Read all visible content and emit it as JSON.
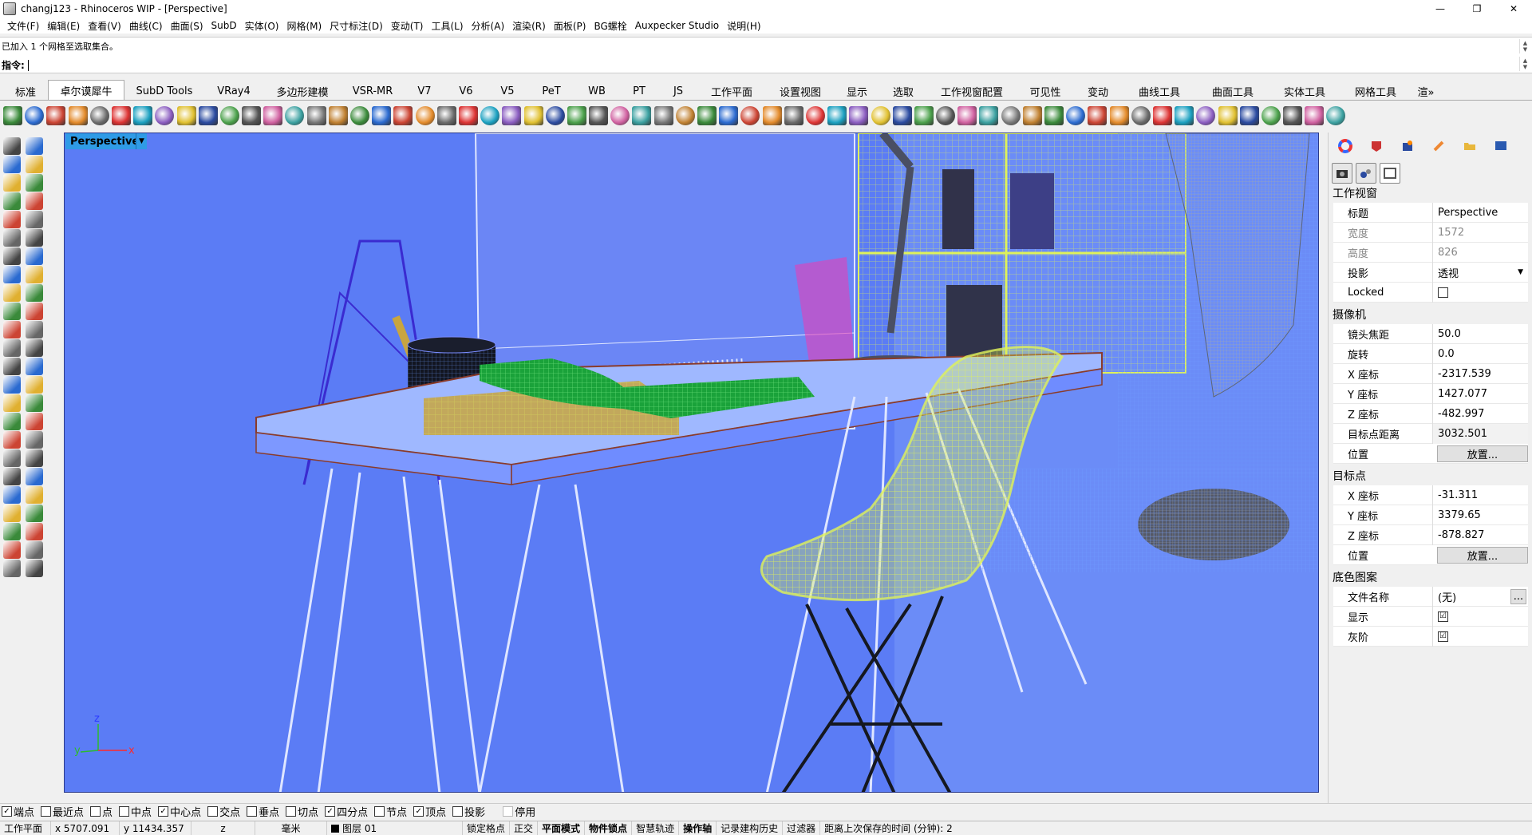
{
  "window": {
    "title": "changj123 - Rhinoceros WIP - [Perspective]",
    "minimize": "—",
    "restore": "❐",
    "close": "✕"
  },
  "menu": [
    "文件(F)",
    "编辑(E)",
    "查看(V)",
    "曲线(C)",
    "曲面(S)",
    "SubD",
    "实体(O)",
    "网格(M)",
    "尺寸标注(D)",
    "变动(T)",
    "工具(L)",
    "分析(A)",
    "渲染(R)",
    "面板(P)",
    "BG螺栓",
    "Auxpecker Studio",
    "说明(H)"
  ],
  "command": {
    "history": "已加入 1 个网格至选取集合。",
    "prompt": "指令:"
  },
  "tabs": [
    "标准",
    "卓尔谟犀牛",
    "SubD Tools",
    "VRay4",
    "多边形建模",
    "VSR-MR",
    "V7",
    "V6",
    "V5",
    "PeT",
    "WB",
    "PT",
    "JS",
    "工作平面",
    "设置视图",
    "显示",
    "选取",
    "工作视窗配置",
    "可见性",
    "变动",
    "曲线工具",
    "曲面工具",
    "实体工具",
    "网格工具",
    "渲»"
  ],
  "active_tab": "卓尔谟犀牛",
  "viewport": {
    "name": "Perspective",
    "axis_x": "x",
    "axis_y": "y",
    "axis_z": "z"
  },
  "panel": {
    "viewport_section": "工作视窗",
    "rows_viewport": [
      {
        "label": "标题",
        "value": "Perspective"
      },
      {
        "label": "宽度",
        "value": "1572"
      },
      {
        "label": "高度",
        "value": "826"
      },
      {
        "label": "投影",
        "value": "透视"
      },
      {
        "label": "Locked",
        "value": ""
      }
    ],
    "camera_section": "摄像机",
    "rows_camera": [
      {
        "label": "镜头焦距",
        "value": "50.0"
      },
      {
        "label": "旋转",
        "value": "0.0"
      },
      {
        "label": "X 座标",
        "value": "-2317.539"
      },
      {
        "label": "Y 座标",
        "value": "1427.077"
      },
      {
        "label": "Z 座标",
        "value": "-482.997"
      },
      {
        "label": "目标点距离",
        "value": "3032.501"
      },
      {
        "label": "位置",
        "value": "放置..."
      }
    ],
    "target_section": "目标点",
    "rows_target": [
      {
        "label": "X 座标",
        "value": "-31.311"
      },
      {
        "label": "Y 座标",
        "value": "3379.65"
      },
      {
        "label": "Z 座标",
        "value": "-878.827"
      },
      {
        "label": "位置",
        "value": "放置..."
      }
    ],
    "wallpaper_section": "底色图案",
    "rows_wallpaper": [
      {
        "label": "文件名称",
        "value": "(无)",
        "button": "..."
      },
      {
        "label": "显示",
        "value": "☑"
      },
      {
        "label": "灰阶",
        "value": "☑"
      }
    ]
  },
  "osnap": [
    {
      "label": "端点",
      "checked": true
    },
    {
      "label": "最近点",
      "checked": false
    },
    {
      "label": "点",
      "checked": false
    },
    {
      "label": "中点",
      "checked": false
    },
    {
      "label": "中心点",
      "checked": true
    },
    {
      "label": "交点",
      "checked": false
    },
    {
      "label": "垂点",
      "checked": false
    },
    {
      "label": "切点",
      "checked": false
    },
    {
      "label": "四分点",
      "checked": true
    },
    {
      "label": "节点",
      "checked": false
    },
    {
      "label": "顶点",
      "checked": true
    },
    {
      "label": "投影",
      "checked": false
    },
    {
      "label": "停用",
      "checked": false
    }
  ],
  "status": {
    "cplane": "工作平面",
    "x": "x 5707.091",
    "y": "y 11434.357",
    "z": "z",
    "unit": "毫米",
    "layer": "图层 01",
    "grid_snap": "锁定格点",
    "ortho": "正交",
    "planar": "平面模式",
    "osnap": "物件锁点",
    "smart_track": "智慧轨迹",
    "gumball": "操作轴",
    "history": "记录建构历史",
    "filter": "过滤器",
    "autosave": "距离上次保存的时间 (分钟): 2"
  },
  "colors": {
    "viewport_bg": "#5b7cf5",
    "viewport_label": "#2f9be6",
    "wire_yellow": "#dff25a",
    "wire_green": "#1aa23a",
    "wire_blue": "#6f9cff"
  }
}
